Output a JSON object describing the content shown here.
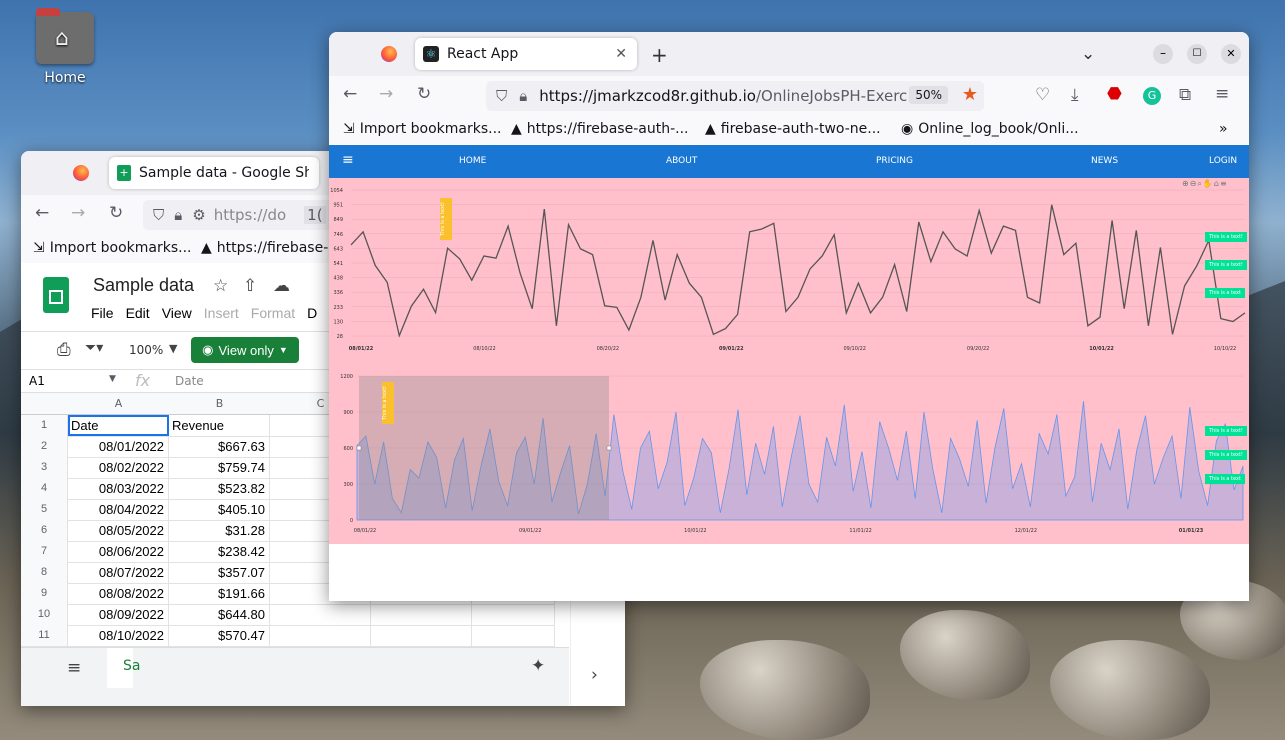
{
  "desktop": {
    "home_label": "Home"
  },
  "sheets_window": {
    "tab_title": "Sample data - Google She",
    "url": "https://do",
    "url_suffix": "1(",
    "bookmarks": [
      "Import bookmarks...",
      "https://firebase-"
    ],
    "doc_title": "Sample data",
    "menu": [
      "File",
      "Edit",
      "View",
      "Insert",
      "Format",
      "D"
    ],
    "zoom": "100%",
    "view_only": "View only",
    "cell_ref": "A1",
    "fx": "fx",
    "formula_value": "Date",
    "col_headers": [
      "A",
      "B",
      "C"
    ],
    "rows": [
      {
        "n": "1",
        "a": "Date",
        "b": "Revenue"
      },
      {
        "n": "2",
        "a": "08/01/2022",
        "b": "$667.63"
      },
      {
        "n": "3",
        "a": "08/02/2022",
        "b": "$759.74"
      },
      {
        "n": "4",
        "a": "08/03/2022",
        "b": "$523.82"
      },
      {
        "n": "5",
        "a": "08/04/2022",
        "b": "$405.10"
      },
      {
        "n": "6",
        "a": "08/05/2022",
        "b": "$31.28"
      },
      {
        "n": "7",
        "a": "08/06/2022",
        "b": "$238.42"
      },
      {
        "n": "8",
        "a": "08/07/2022",
        "b": "$357.07"
      },
      {
        "n": "9",
        "a": "08/08/2022",
        "b": "$191.66"
      },
      {
        "n": "10",
        "a": "08/09/2022",
        "b": "$644.80"
      },
      {
        "n": "11",
        "a": "08/10/2022",
        "b": "$570.47"
      }
    ],
    "sheet_tab": "Sa"
  },
  "react_window": {
    "tab_title": "React App",
    "url_host": "https://jmarkzcod8r.github.io",
    "url_path": "/OnlineJobsPH-Exerc",
    "zoom_badge": "50%",
    "bookmarks": [
      "Import bookmarks...",
      "https://firebase-auth-...",
      "firebase-auth-two-ne...",
      "Online_log_book/Onli..."
    ],
    "nav": {
      "menu_icon": "≡",
      "home": "HOME",
      "about": "ABOUT",
      "pricing": "PRICING",
      "news": "NEWS",
      "login": "LOGIN"
    },
    "annotations": {
      "vertical": "This is a text!",
      "badge1": "This is a text!",
      "badge2": "This is a text!",
      "badge3": "This is a text"
    }
  },
  "chart_data": [
    {
      "type": "line",
      "color": "#555555",
      "y_ticks": [
        "1054",
        "951",
        "849",
        "746",
        "643",
        "541",
        "438",
        "336",
        "233",
        "130",
        "28"
      ],
      "x_ticks": [
        "08/01/22",
        "08/10/22",
        "08/20/22",
        "09/01/22",
        "09/10/22",
        "09/20/22",
        "10/01/22",
        "10/10/22"
      ],
      "ylim": [
        28,
        1054
      ],
      "series": [
        {
          "values": [
            668,
            760,
            524,
            405,
            31,
            238,
            357,
            192,
            645,
            570,
            420,
            590,
            575,
            800,
            470,
            220,
            920,
            100,
            810,
            640,
            600,
            240,
            230,
            70,
            300,
            700,
            280,
            600,
            400,
            300,
            40,
            80,
            180,
            760,
            780,
            820,
            200,
            300,
            500,
            590,
            740,
            190,
            400,
            190,
            300,
            530,
            200,
            830,
            550,
            760,
            640,
            590,
            910,
            610,
            800,
            770,
            300,
            260,
            950,
            600,
            680,
            100,
            160,
            840,
            220,
            770,
            100,
            650,
            40,
            380,
            520,
            700,
            150,
            130,
            190
          ]
        }
      ]
    },
    {
      "type": "area",
      "color": "#6495ed",
      "y_ticks": [
        "1200",
        "900",
        "600",
        "300",
        "0"
      ],
      "x_ticks": [
        "08/01/22",
        "09/01/22",
        "10/01/22",
        "11/01/22",
        "12/01/22",
        "01/01/23"
      ],
      "ylim": [
        0,
        1200
      ],
      "series": [
        {
          "values": [
            620,
            700,
            300,
            650,
            180,
            60,
            420,
            350,
            650,
            520,
            100,
            500,
            680,
            80,
            450,
            760,
            320,
            120,
            560,
            690,
            300,
            850,
            150,
            400,
            620,
            50,
            300,
            720,
            200,
            880,
            410,
            90,
            600,
            740,
            260,
            480,
            900,
            120,
            350,
            680,
            560,
            60,
            430,
            920,
            210,
            640,
            380,
            780,
            110,
            520,
            870,
            300,
            150,
            690,
            450,
            960,
            240,
            570,
            100,
            820,
            600,
            330,
            740,
            180,
            900,
            420,
            60,
            680,
            510,
            280,
            830,
            140,
            600,
            930,
            260,
            470,
            110,
            720,
            550,
            880,
            200,
            360,
            990,
            150,
            640,
            420,
            760,
            90,
            580,
            870,
            300,
            520,
            700,
            180,
            940,
            410,
            120,
            660,
            800,
            250,
            450
          ]
        }
      ]
    }
  ]
}
